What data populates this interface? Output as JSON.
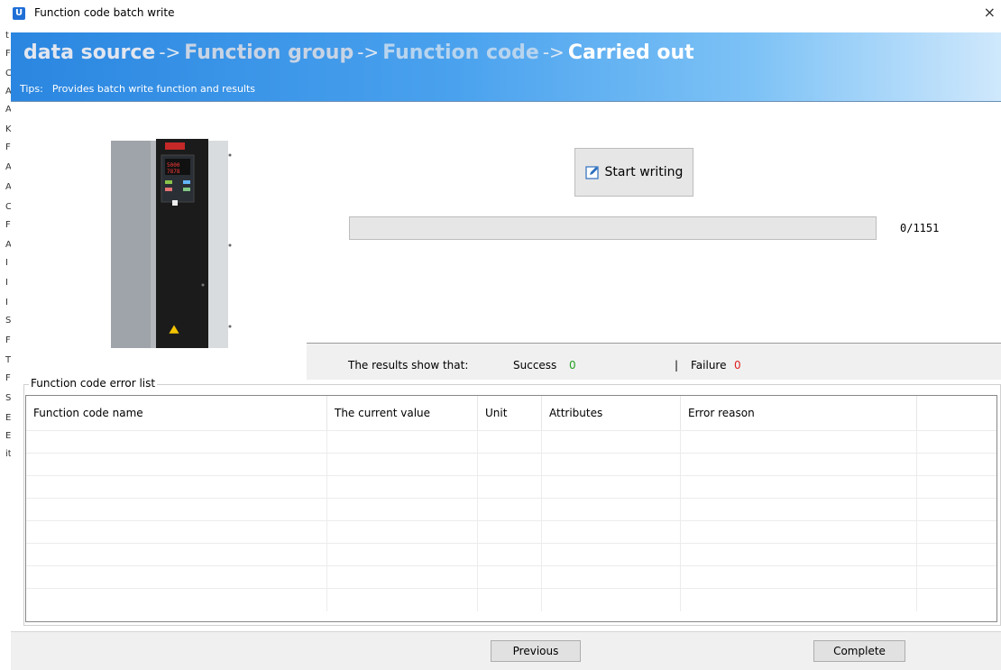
{
  "window": {
    "title": "Function code batch write",
    "close_glyph": "×"
  },
  "wizard": {
    "steps": [
      "data source",
      "Function group",
      "Function code",
      "Carried out"
    ],
    "arrow": "->",
    "tips_label": "Tips:",
    "tips_text": "Provides batch write function and results"
  },
  "left_strip_chars": [
    "t",
    "F",
    "C",
    "A",
    "A",
    "K",
    "F",
    "A",
    "A",
    "C",
    "F",
    "A",
    "I",
    "I",
    "I",
    "S",
    "F",
    "T",
    "F",
    "S",
    "E",
    "E",
    "it"
  ],
  "writing": {
    "start_label": "Start writing",
    "progress_fraction": 0,
    "progress_text": "0/1151"
  },
  "results": {
    "label": "The results show that:",
    "success_label": "Success",
    "success_count": "0",
    "separator": "|",
    "failure_label": "Failure",
    "failure_count": "0"
  },
  "error_list": {
    "legend": "Function code error list",
    "columns": [
      "Function code name",
      "The current value",
      "Unit",
      "Attributes",
      "Error reason",
      ""
    ],
    "rows": [
      [],
      [],
      [],
      [],
      [],
      [],
      [],
      []
    ]
  },
  "footer": {
    "previous_label": "Previous",
    "complete_label": "Complete"
  },
  "colors": {
    "success": "#23a023",
    "failure": "#e02020",
    "banner_start": "#2a86e0",
    "banner_end": "#cfe8fc"
  },
  "icons": {
    "app": "app-icon",
    "close": "close-icon",
    "start_writing": "edit-icon",
    "product": "inverter-image"
  }
}
